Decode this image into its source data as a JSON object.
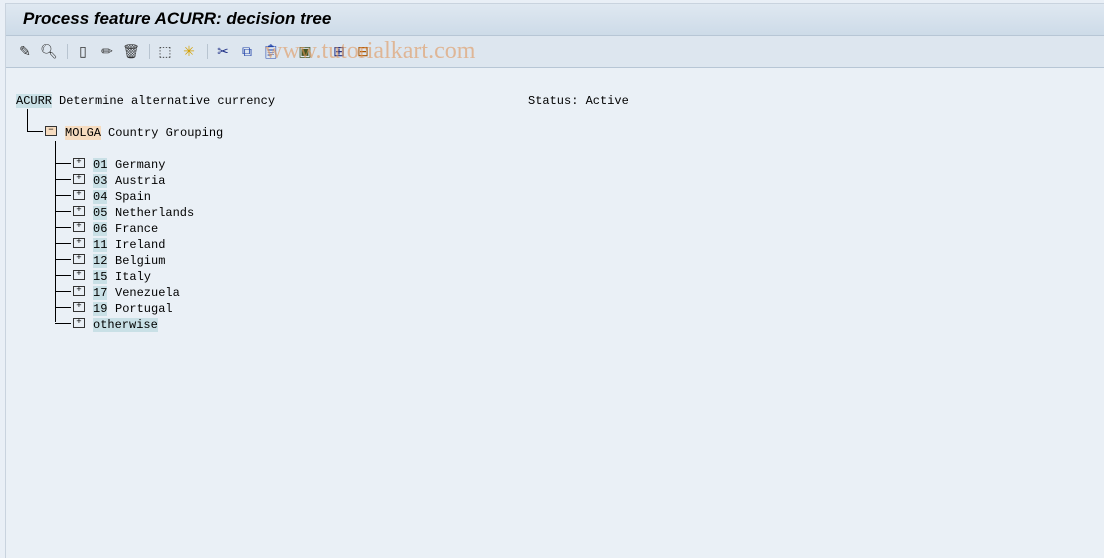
{
  "window": {
    "title": "Process feature ACURR: decision tree"
  },
  "toolbar": {
    "icons": [
      "display-change-icon",
      "find-icon",
      "create-icon",
      "change-icon",
      "delete-icon",
      "move-node-icon",
      "node-insert-icon",
      "cut-icon",
      "copy-icon",
      "paste-icon",
      "print-icon",
      "expand-subtree-icon",
      "collapse-subtree-icon"
    ]
  },
  "watermark": "www.tutorialkart.com",
  "tree": {
    "root": {
      "key": "ACURR",
      "text": "Determine alternative currency",
      "status": "Status: Active"
    },
    "field": {
      "key": "MOLGA",
      "text": "Country Grouping"
    },
    "children": [
      {
        "key": "01",
        "text": "Germany"
      },
      {
        "key": "03",
        "text": "Austria"
      },
      {
        "key": "04",
        "text": "Spain"
      },
      {
        "key": "05",
        "text": "Netherlands"
      },
      {
        "key": "06",
        "text": "France"
      },
      {
        "key": "11",
        "text": "Ireland"
      },
      {
        "key": "12",
        "text": "Belgium"
      },
      {
        "key": "15",
        "text": "Italy"
      },
      {
        "key": "17",
        "text": "Venezuela"
      },
      {
        "key": "19",
        "text": "Portugal"
      },
      {
        "key": "otherwise",
        "text": ""
      }
    ]
  }
}
